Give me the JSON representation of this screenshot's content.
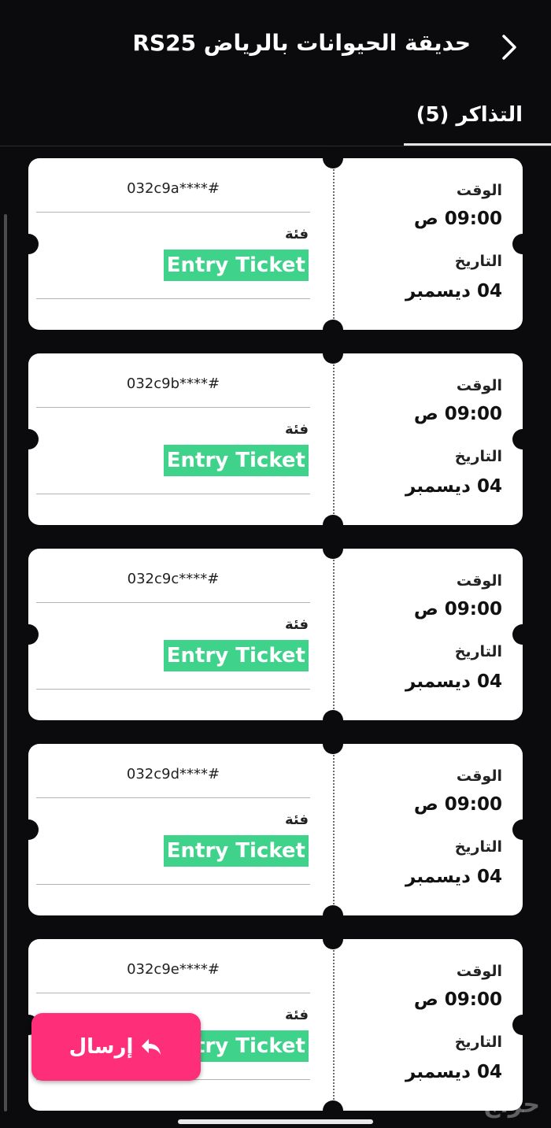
{
  "header": {
    "title": "حديقة الحيوانات بالرياض RS25"
  },
  "tabs": [
    {
      "label": "التذاكر (5)"
    }
  ],
  "tickets": [
    {
      "code": "032c9a****#",
      "category_label": "فئة",
      "category": "Entry Ticket",
      "time_label": "الوقت",
      "time": "09:00 ص",
      "date_label": "التاريخ",
      "date": "04 ديسمبر"
    },
    {
      "code": "032c9b****#",
      "category_label": "فئة",
      "category": "Entry Ticket",
      "time_label": "الوقت",
      "time": "09:00 ص",
      "date_label": "التاريخ",
      "date": "04 ديسمبر"
    },
    {
      "code": "032c9c****#",
      "category_label": "فئة",
      "category": "Entry Ticket",
      "time_label": "الوقت",
      "time": "09:00 ص",
      "date_label": "التاريخ",
      "date": "04 ديسمبر"
    },
    {
      "code": "032c9d****#",
      "category_label": "فئة",
      "category": "Entry Ticket",
      "time_label": "الوقت",
      "time": "09:00 ص",
      "date_label": "التاريخ",
      "date": "04 ديسمبر"
    },
    {
      "code": "032c9e****#",
      "category_label": "فئة",
      "category": "Entry Ticket",
      "time_label": "الوقت",
      "time": "09:00 ص",
      "date_label": "التاريخ",
      "date": "04 ديسمبر"
    }
  ],
  "send_button": {
    "label": "إرسال",
    "icon": "reply-arrow-icon"
  },
  "watermark": "حراج",
  "colors": {
    "background": "#0b0b0d",
    "badge": "#3ed28a",
    "send_button": "#ff2e79"
  }
}
